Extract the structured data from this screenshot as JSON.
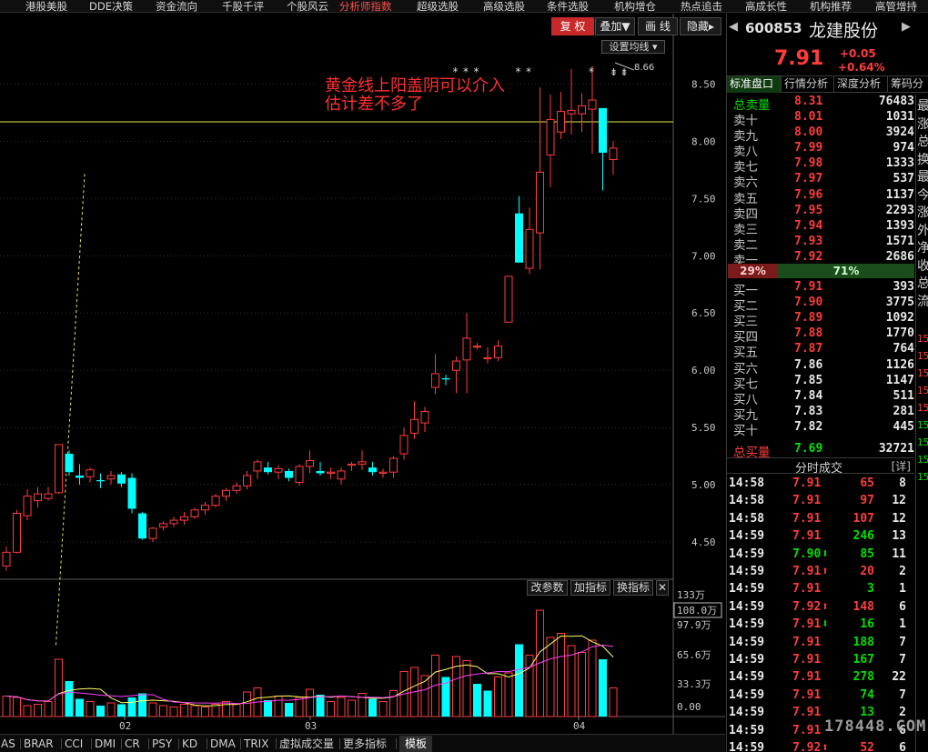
{
  "menu": [
    "港股美股",
    "DDE决策",
    "资金流向",
    "千股千评",
    "个股风云",
    "分析师指数",
    "超级选股",
    "高级选股",
    "条件选股",
    "机构增仓",
    "热点追击",
    "高成长性",
    "机构推荐",
    "高管增持"
  ],
  "menu_active_index": 5,
  "toolbar": {
    "fuquan": "复 权",
    "diejia": "叠加▼",
    "huaxian": "画 线",
    "yincang": "隐藏▸"
  },
  "set_ma_label": "设置均线 ▾",
  "annotation": {
    "line1": "黄金线上阳盖阴可以介入",
    "line2": "估计差不多了"
  },
  "peak_label": "8.66",
  "indicator_buttons": {
    "gaicanshu": "改参数",
    "jiazhibiao": "加指标",
    "huanzhibiao": "换指标",
    "close": "✕"
  },
  "indicator_tabs": [
    "AS",
    "BRAR",
    "CCI",
    "DMI",
    "CR",
    "PSY",
    "KD",
    "DMA",
    "TRIX",
    "虚拟成交量",
    "更多指标",
    "模板"
  ],
  "indicator_tab_active": 11,
  "chart_data": {
    "type": "candlestick",
    "price_axis_ticks": [
      "8.50",
      "8.00",
      "7.50",
      "7.00",
      "6.50",
      "6.00",
      "5.50",
      "5.00",
      "4.50"
    ],
    "volume_axis_ticks": [
      "133万",
      "108.0万",
      "97.9万",
      "65.6万",
      "33.3万",
      "0.00"
    ],
    "x_labels": [
      "02",
      "03",
      "04"
    ],
    "golden_line_price": 8.17,
    "trendline": [
      [
        4.74,
        3.6
      ],
      [
        7.49,
        7.73
      ]
    ],
    "candles": [
      [
        4.29,
        4.46,
        4.25,
        4.41
      ],
      [
        4.41,
        4.78,
        4.4,
        4.75
      ],
      [
        4.73,
        4.96,
        4.69,
        4.9
      ],
      [
        4.86,
        4.98,
        4.8,
        4.92
      ],
      [
        4.88,
        4.98,
        4.86,
        4.92
      ],
      [
        4.93,
        5.35,
        4.92,
        5.35
      ],
      [
        5.27,
        5.3,
        5.08,
        5.11
      ],
      [
        5.08,
        5.18,
        5.0,
        5.06
      ],
      [
        5.07,
        5.15,
        5.02,
        5.13
      ],
      [
        5.04,
        5.1,
        4.97,
        5.03
      ],
      [
        5.05,
        5.12,
        5.0,
        5.08
      ],
      [
        5.09,
        5.11,
        4.98,
        5.01
      ],
      [
        5.06,
        5.1,
        4.75,
        4.79
      ],
      [
        4.75,
        4.76,
        4.52,
        4.53
      ],
      [
        4.53,
        4.63,
        4.5,
        4.62
      ],
      [
        4.63,
        4.68,
        4.6,
        4.66
      ],
      [
        4.66,
        4.72,
        4.63,
        4.69
      ],
      [
        4.69,
        4.76,
        4.65,
        4.72
      ],
      [
        4.72,
        4.8,
        4.7,
        4.78
      ],
      [
        4.78,
        4.85,
        4.74,
        4.82
      ],
      [
        4.82,
        4.92,
        4.8,
        4.9
      ],
      [
        4.9,
        4.97,
        4.86,
        4.95
      ],
      [
        4.95,
        5.02,
        4.92,
        4.99
      ],
      [
        4.99,
        5.12,
        4.96,
        5.08
      ],
      [
        5.12,
        5.22,
        5.05,
        5.2
      ],
      [
        5.15,
        5.2,
        5.09,
        5.11
      ],
      [
        5.11,
        5.17,
        5.05,
        5.14
      ],
      [
        5.12,
        5.14,
        5.03,
        5.06
      ],
      [
        5.02,
        5.18,
        4.99,
        5.16
      ],
      [
        5.16,
        5.3,
        5.1,
        5.21
      ],
      [
        5.12,
        5.2,
        5.08,
        5.1
      ],
      [
        5.1,
        5.15,
        5.05,
        5.11
      ],
      [
        5.05,
        5.15,
        5.0,
        5.12
      ],
      [
        5.17,
        5.2,
        5.12,
        5.18
      ],
      [
        5.18,
        5.3,
        5.13,
        5.2
      ],
      [
        5.15,
        5.2,
        5.08,
        5.11
      ],
      [
        5.1,
        5.14,
        5.06,
        5.11
      ],
      [
        5.11,
        5.25,
        5.06,
        5.23
      ],
      [
        5.27,
        5.5,
        5.22,
        5.43
      ],
      [
        5.45,
        5.73,
        5.4,
        5.57
      ],
      [
        5.54,
        5.68,
        5.46,
        5.64
      ],
      [
        5.85,
        6.14,
        5.79,
        5.97
      ],
      [
        5.93,
        5.96,
        5.87,
        5.92
      ],
      [
        6.0,
        6.12,
        5.8,
        6.08
      ],
      [
        6.09,
        6.5,
        5.8,
        6.28
      ],
      [
        6.21,
        6.24,
        6.18,
        6.21
      ],
      [
        6.1,
        6.2,
        6.06,
        6.11
      ],
      [
        6.11,
        6.26,
        6.08,
        6.21
      ],
      [
        6.42,
        6.82,
        6.42,
        6.82
      ],
      [
        7.37,
        7.52,
        6.94,
        6.94
      ],
      [
        6.89,
        7.42,
        6.84,
        7.23
      ],
      [
        7.2,
        8.47,
        6.88,
        7.73
      ],
      [
        7.88,
        8.41,
        7.6,
        8.19
      ],
      [
        8.08,
        8.43,
        8.02,
        8.26
      ],
      [
        8.24,
        8.63,
        8.06,
        8.27
      ],
      [
        8.24,
        8.42,
        8.08,
        8.31
      ],
      [
        8.28,
        8.66,
        7.89,
        8.36
      ],
      [
        8.29,
        8.29,
        7.57,
        7.9
      ],
      [
        7.84,
        8.0,
        7.71,
        7.94
      ]
    ],
    "volume_bars": [
      [
        15,
        1
      ],
      [
        14,
        1
      ],
      [
        8,
        1
      ],
      [
        9,
        1
      ],
      [
        11,
        1
      ],
      [
        42,
        1
      ],
      [
        26,
        0
      ],
      [
        13,
        0
      ],
      [
        11,
        1
      ],
      [
        8,
        0
      ],
      [
        10,
        1
      ],
      [
        9,
        0
      ],
      [
        14,
        0
      ],
      [
        17,
        0
      ],
      [
        10,
        1
      ],
      [
        8,
        1
      ],
      [
        7,
        1
      ],
      [
        9,
        1
      ],
      [
        8,
        1
      ],
      [
        7,
        1
      ],
      [
        9,
        1
      ],
      [
        11,
        1
      ],
      [
        9,
        1
      ],
      [
        18,
        1
      ],
      [
        21,
        1
      ],
      [
        12,
        0
      ],
      [
        15,
        1
      ],
      [
        10,
        0
      ],
      [
        14,
        1
      ],
      [
        20,
        1
      ],
      [
        16,
        0
      ],
      [
        11,
        1
      ],
      [
        14,
        1
      ],
      [
        12,
        1
      ],
      [
        17,
        1
      ],
      [
        13,
        0
      ],
      [
        11,
        1
      ],
      [
        19,
        1
      ],
      [
        33,
        1
      ],
      [
        36,
        1
      ],
      [
        30,
        1
      ],
      [
        45,
        1
      ],
      [
        29,
        0
      ],
      [
        44,
        1
      ],
      [
        41,
        1
      ],
      [
        24,
        0
      ],
      [
        19,
        0
      ],
      [
        29,
        1
      ],
      [
        32,
        1
      ],
      [
        53,
        0
      ],
      [
        45,
        1
      ],
      [
        78,
        1
      ],
      [
        58,
        1
      ],
      [
        61,
        1
      ],
      [
        52,
        1
      ],
      [
        47,
        1
      ],
      [
        56,
        1
      ],
      [
        42,
        0
      ],
      [
        21,
        1
      ]
    ]
  },
  "stock": {
    "code": "600853",
    "name": "龙建股份",
    "price": "7.91",
    "change": "+0.05",
    "change_pct": "+0.64%"
  },
  "right_tabs": [
    "标准盘口",
    "行情分析",
    "深度分析",
    "筹码分"
  ],
  "order_book": {
    "total_sell": {
      "label": "总卖量",
      "price": "8.31",
      "vol": "76483"
    },
    "asks": [
      {
        "label": "卖十",
        "price": "8.01",
        "vol": "1031"
      },
      {
        "label": "卖九",
        "price": "8.00",
        "vol": "3924"
      },
      {
        "label": "卖八",
        "price": "7.99",
        "vol": "974"
      },
      {
        "label": "卖七",
        "price": "7.98",
        "vol": "1333"
      },
      {
        "label": "卖六",
        "price": "7.97",
        "vol": "537"
      },
      {
        "label": "卖五",
        "price": "7.96",
        "vol": "1137"
      },
      {
        "label": "卖四",
        "price": "7.95",
        "vol": "2293"
      },
      {
        "label": "卖三",
        "price": "7.94",
        "vol": "1393"
      },
      {
        "label": "卖二",
        "price": "7.93",
        "vol": "1571"
      },
      {
        "label": "卖一",
        "price": "7.92",
        "vol": "2686"
      }
    ],
    "ratio": {
      "left": "29%",
      "right": "71%"
    },
    "bids": [
      {
        "label": "买一",
        "price": "7.91",
        "vol": "393",
        "up": true
      },
      {
        "label": "买二",
        "price": "7.90",
        "vol": "3775",
        "up": true
      },
      {
        "label": "买三",
        "price": "7.89",
        "vol": "1092",
        "up": true
      },
      {
        "label": "买四",
        "price": "7.88",
        "vol": "1770",
        "up": true
      },
      {
        "label": "买五",
        "price": "7.87",
        "vol": "764",
        "up": true
      },
      {
        "label": "买六",
        "price": "7.86",
        "vol": "1126",
        "up": false
      },
      {
        "label": "买七",
        "price": "7.85",
        "vol": "1147",
        "up": false
      },
      {
        "label": "买八",
        "price": "7.84",
        "vol": "511",
        "up": false
      },
      {
        "label": "买九",
        "price": "7.83",
        "vol": "281",
        "up": false
      },
      {
        "label": "买十",
        "price": "7.82",
        "vol": "445",
        "up": false
      }
    ],
    "total_buy": {
      "label": "总买量",
      "price": "7.69",
      "vol": "32721"
    }
  },
  "ticks_header": {
    "title": "分时成交",
    "detail": "[详]"
  },
  "ticks": [
    {
      "time": "14:58",
      "price": "7.91",
      "dir": "",
      "vol": "65",
      "n": "8",
      "side": "sell"
    },
    {
      "time": "14:58",
      "price": "7.91",
      "dir": "",
      "vol": "97",
      "n": "12",
      "side": "sell"
    },
    {
      "time": "14:58",
      "price": "7.91",
      "dir": "",
      "vol": "107",
      "n": "12",
      "side": "sell"
    },
    {
      "time": "14:59",
      "price": "7.91",
      "dir": "",
      "vol": "246",
      "n": "13",
      "side": "buy"
    },
    {
      "time": "14:59",
      "price": "7.90",
      "dir": "⬇",
      "vol": "85",
      "n": "11",
      "side": "buy"
    },
    {
      "time": "14:59",
      "price": "7.91",
      "dir": "⬆",
      "vol": "20",
      "n": "2",
      "side": "sell"
    },
    {
      "time": "14:59",
      "price": "7.91",
      "dir": "",
      "vol": "3",
      "n": "1",
      "side": "buy"
    },
    {
      "time": "14:59",
      "price": "7.92",
      "dir": "⬆",
      "vol": "148",
      "n": "6",
      "side": "sell"
    },
    {
      "time": "14:59",
      "price": "7.91",
      "dir": "⬇",
      "vol": "16",
      "n": "1",
      "side": "buy"
    },
    {
      "time": "14:59",
      "price": "7.91",
      "dir": "",
      "vol": "188",
      "n": "7",
      "side": "buy"
    },
    {
      "time": "14:59",
      "price": "7.91",
      "dir": "",
      "vol": "167",
      "n": "7",
      "side": "buy"
    },
    {
      "time": "14:59",
      "price": "7.91",
      "dir": "",
      "vol": "278",
      "n": "22",
      "side": "buy"
    },
    {
      "time": "14:59",
      "price": "7.91",
      "dir": "",
      "vol": "74",
      "n": "7",
      "side": "buy"
    },
    {
      "time": "14:59",
      "price": "7.91",
      "dir": "",
      "vol": "13",
      "n": "2",
      "side": "buy"
    },
    {
      "time": "14:59",
      "price": "7.91",
      "dir": "",
      "vol": "",
      "n": "6",
      "side": "sell"
    },
    {
      "time": "14:59",
      "price": "7.92",
      "dir": "⬆",
      "vol": "52",
      "n": "6",
      "side": "sell"
    }
  ],
  "side_strip_glyphs": [
    "最",
    "涨",
    "总",
    "换",
    "最",
    "今",
    "涨",
    "外",
    "净",
    "收",
    "总",
    "流"
  ],
  "side_strip_nums": [
    "15",
    "15",
    "15",
    "15",
    "15",
    "15",
    "15",
    "15",
    "15"
  ],
  "watermark": "178448.COM",
  "colors": {
    "up": "#ff3c3c",
    "down": "#00ffff",
    "golden": "#e6e64e",
    "ma": "#ff40ff",
    "ma2": "#ffff66",
    "green": "#00e000"
  }
}
